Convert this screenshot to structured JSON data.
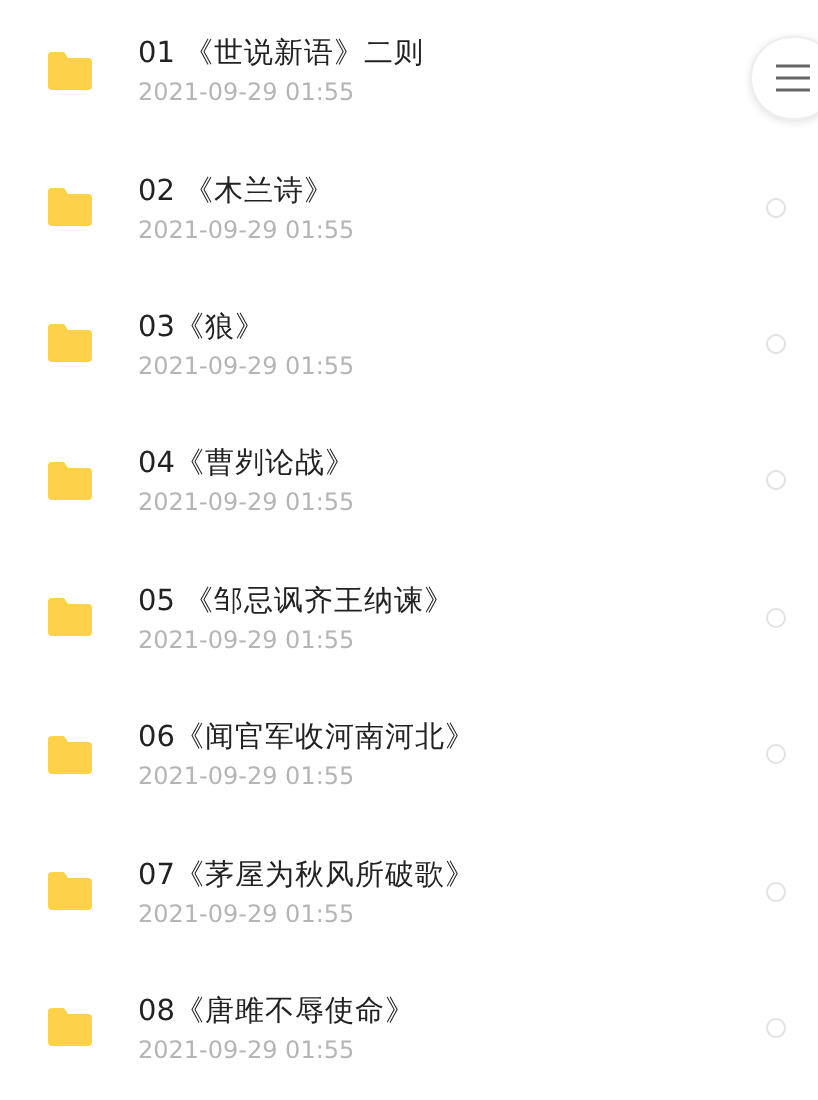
{
  "files": [
    {
      "title": "01 《世说新语》二则",
      "date": "2021-09-29 01:55"
    },
    {
      "title": "02 《木兰诗》",
      "date": "2021-09-29 01:55",
      "selected": false
    },
    {
      "title": "03《狼》",
      "date": "2021-09-29 01:55",
      "selected": false
    },
    {
      "title": "04《曹刿论战》",
      "date": "2021-09-29 01:55",
      "selected": false
    },
    {
      "title": "05 《邹忌讽齐王纳谏》",
      "date": "2021-09-29 01:55",
      "selected": false
    },
    {
      "title": "06《闻官军收河南河北》",
      "date": "2021-09-29 01:55",
      "selected": false
    },
    {
      "title": "07《茅屋为秋风所破歌》",
      "date": "2021-09-29 01:55",
      "selected": false
    },
    {
      "title": "08《唐雎不辱使命》",
      "date": "2021-09-29 01:55",
      "selected": false
    }
  ]
}
